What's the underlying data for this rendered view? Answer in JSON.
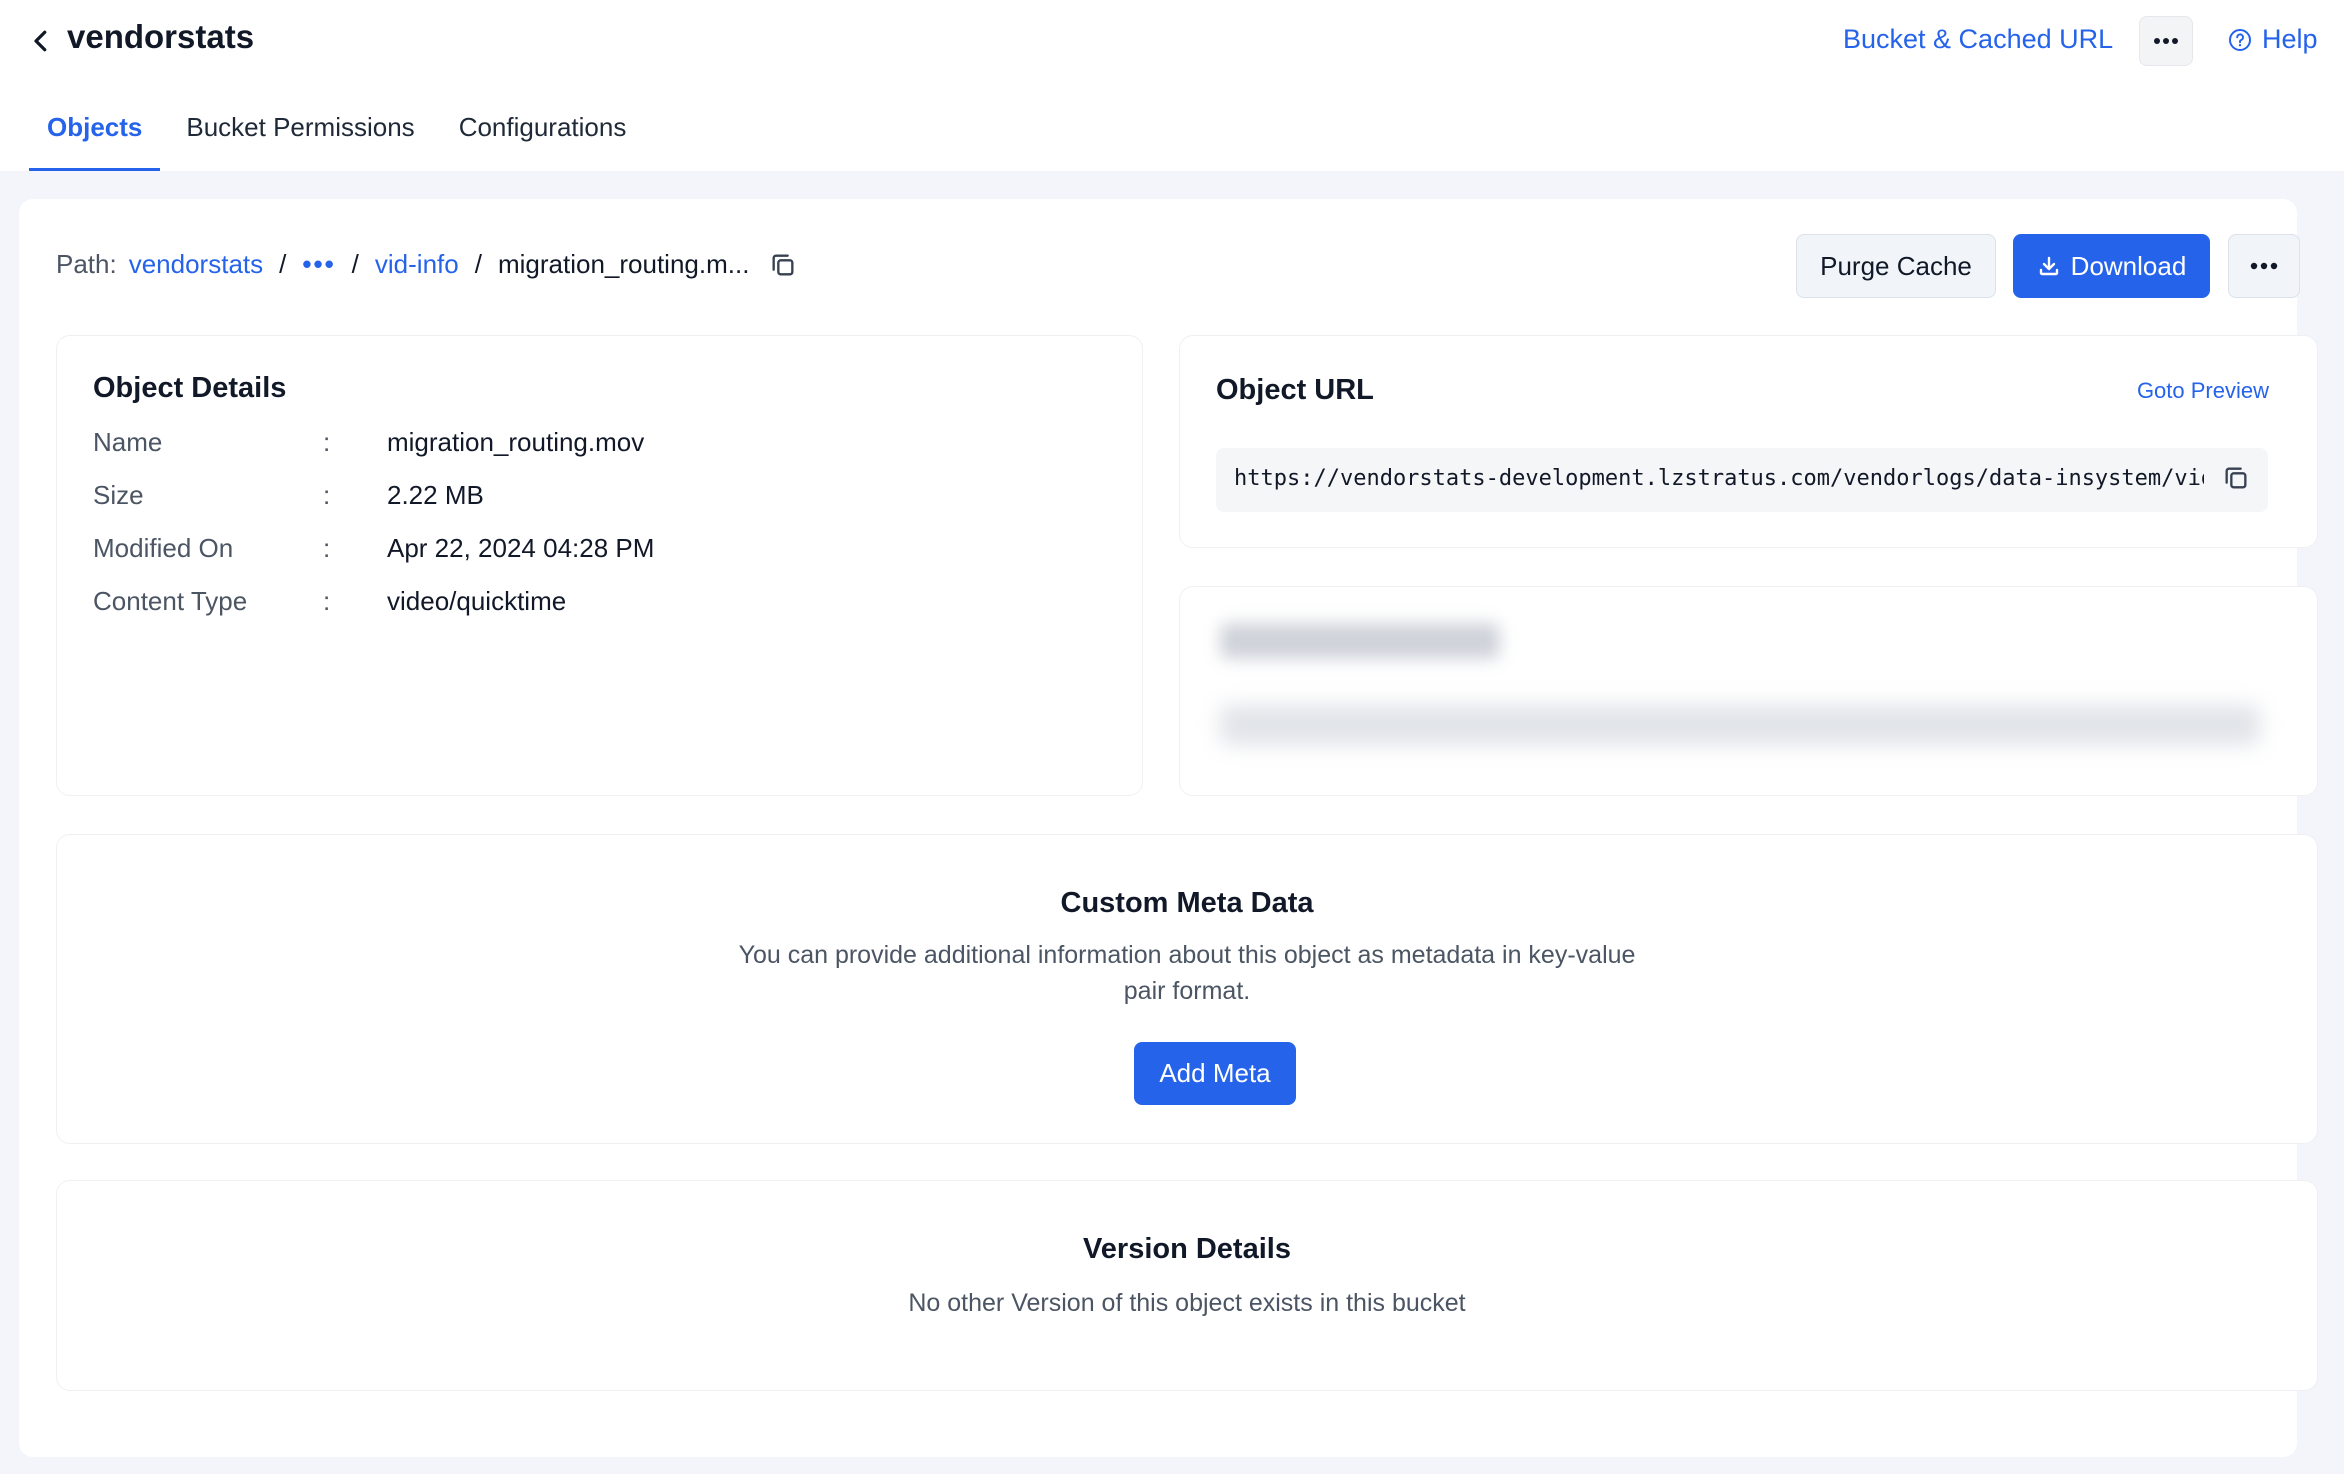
{
  "header": {
    "bucket_name": "vendorstats",
    "bucket_cached_url_label": "Bucket & Cached URL",
    "help_label": "Help"
  },
  "tabs": [
    {
      "label": "Objects",
      "active": true
    },
    {
      "label": "Bucket Permissions",
      "active": false
    },
    {
      "label": "Configurations",
      "active": false
    }
  ],
  "path": {
    "label": "Path:",
    "crumbs": [
      "vendorstats",
      "vid-info"
    ],
    "ellipsis": "•••",
    "separator": "/",
    "current": "migration_routing.m..."
  },
  "actions": {
    "purge_cache": "Purge Cache",
    "download": "Download"
  },
  "object_details": {
    "title": "Object Details",
    "rows": [
      {
        "key": "Name",
        "value": "migration_routing.mov"
      },
      {
        "key": "Size",
        "value": "2.22 MB"
      },
      {
        "key": "Modified On",
        "value": "Apr 22, 2024 04:28 PM"
      },
      {
        "key": "Content Type",
        "value": "video/quicktime"
      }
    ],
    "colon": ":"
  },
  "object_url": {
    "title": "Object URL",
    "goto_preview": "Goto Preview",
    "url": "https://vendorstats-development.lzstratus.com/vendorlogs/data-insystem/vid-"
  },
  "custom_meta": {
    "title": "Custom Meta Data",
    "description_line1": "You can provide additional information about this object as metadata in key-value",
    "description_line2": "pair format.",
    "add_button": "Add Meta"
  },
  "version_details": {
    "title": "Version Details",
    "description": "No other Version of this object exists in this bucket"
  },
  "colors": {
    "accent": "#2563eb",
    "background": "#f3f5fb",
    "text_primary": "#111827",
    "text_secondary": "#4b5563"
  }
}
